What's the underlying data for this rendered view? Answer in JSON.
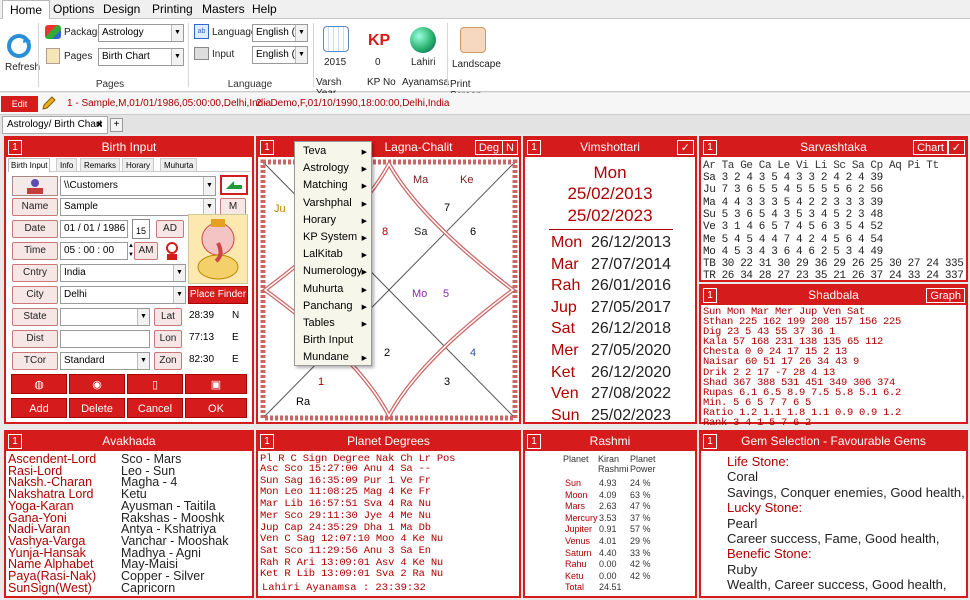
{
  "menu": {
    "tabs": [
      "Home",
      "Options",
      "Design",
      "Printing",
      "Masters",
      "Help"
    ]
  },
  "ribbon": {
    "refresh": "Refresh",
    "package_label": "Package",
    "package_value": "Astrology",
    "pages_label": "Pages",
    "pages_value": "Birth Chart",
    "pages_group": "Pages",
    "language_label": "Language",
    "language_value": "English (E",
    "input_label": "Input",
    "input_value": "English (E",
    "language_group": "Language",
    "varsh_value": "2015",
    "varsh_label": "Varsh Year",
    "kp_icon_text": "KP",
    "kp_value": "0",
    "kp_label": "KP No",
    "ayanamsa_value": "Lahiri",
    "ayanamsa_label": "Ayanamsa",
    "landscape_label": "Landscape",
    "print_screen_label": "Print Screen"
  },
  "profiles": {
    "edit_dob": "Edit DOB",
    "p1": "1 - Sample,M,01/01/1986,05:00:00,Delhi,India",
    "p2": "2 - Demo,F,01/10/1990,18:00:00,Delhi,India"
  },
  "doc_tab": {
    "label": "Astrology/ Birth Chart",
    "close": "✖",
    "add": "+"
  },
  "birth_input": {
    "num": "1",
    "title": "Birth Input",
    "subtabs": [
      "Birth Input",
      "Info",
      "Remarks",
      "Horary",
      "Muhurta"
    ],
    "folder": "\\\\Customers",
    "name_btn": "Name",
    "name_value": "Sample",
    "gender": "M",
    "date_btn": "Date",
    "date_value": "01 / 01 / 1986",
    "cal": "15",
    "ad": "AD",
    "time_btn": "Time",
    "time_value": "05 :  00 :  00",
    "ampm": "AM",
    "cntry_btn": "Cntry",
    "cntry_value": "India",
    "city_btn": "City",
    "city_value": "Delhi",
    "place_finder": "Place Finder",
    "state_btn": "State",
    "lat_btn": "Lat",
    "lat_value": "28:39",
    "lat_dir": "N",
    "dist_btn": "Dist",
    "lon_btn": "Lon",
    "lon_value": "77:13",
    "lon_dir": "E",
    "tcor_btn": "TCor",
    "tcor_value": "Standard",
    "zon_btn": "Zon",
    "zon_value": "82:30",
    "zon_dir": "E",
    "add": "Add",
    "delete": "Delete",
    "cancel": "Cancel",
    "ok": "OK"
  },
  "chart_panel": {
    "num": "1",
    "title": "Lagna-Chalit",
    "deg": "Deg",
    "n": "N",
    "houses": {
      "h12": "12",
      "h2": "2",
      "h7": "7",
      "h8": "8",
      "h6": "6",
      "h5": "5",
      "h3": "3",
      "h4": "4",
      "h1": "1",
      "h10": "10"
    },
    "planets": {
      "ma": "Ma",
      "ke": "Ke",
      "sa": "Sa",
      "ju": "Ju",
      "mo": "Mo",
      "ra": "Ra"
    }
  },
  "context_menu": {
    "items": [
      {
        "label": "Teva",
        "sub": true
      },
      {
        "label": "Astrology",
        "sub": true
      },
      {
        "label": "Matching",
        "sub": true
      },
      {
        "label": "Varshphal",
        "sub": true
      },
      {
        "label": "Horary",
        "sub": true
      },
      {
        "label": "KP System",
        "sub": true
      },
      {
        "label": "LalKitab",
        "sub": true
      },
      {
        "label": "Numerology",
        "sub": true
      },
      {
        "label": "Muhurta",
        "sub": true
      },
      {
        "label": "Panchang",
        "sub": true
      },
      {
        "label": "Tables",
        "sub": true
      },
      {
        "label": "Birth Input",
        "sub": false
      },
      {
        "label": "Mundane",
        "sub": true
      }
    ]
  },
  "vimshottari": {
    "num": "1",
    "title": "Vimshottari",
    "check": "✓",
    "header_day": "Mon",
    "header_d1": "25/02/2013",
    "header_d2": "25/02/2023",
    "rows": [
      {
        "p": "Mon",
        "d": "26/12/2013"
      },
      {
        "p": "Mar",
        "d": "27/07/2014"
      },
      {
        "p": "Rah",
        "d": "26/01/2016"
      },
      {
        "p": "Jup",
        "d": "27/05/2017"
      },
      {
        "p": "Sat",
        "d": "26/12/2018"
      },
      {
        "p": "Mer",
        "d": "27/05/2020"
      },
      {
        "p": "Ket",
        "d": "26/12/2020"
      },
      {
        "p": "Ven",
        "d": "27/08/2022"
      },
      {
        "p": "Sun",
        "d": "25/02/2023"
      }
    ]
  },
  "sarvashtaka": {
    "num": "1",
    "title": "Sarvashtaka",
    "chart_btn": "Chart",
    "check": "✓",
    "header": "   Ar Ta Ge Ca Le Vi Li Sc Sa Cp Aq Pi  Tt",
    "rows": [
      "Sa  3  2  4  3  5  4  3  3  2  4  2  4  39",
      "Ju  7  3  6  5  5  4  5  5  5  5  6  2  56",
      "Ma  4  4  3  3  3  5  4  2  2  3  3  3  39",
      "Su  5  3  6  5  4  3  5  3  4  5  2  3  48",
      "Ve  3  1  4  6  5  7  4  5  6  3  5  4  52",
      "Me  5  4  5  4  4  7  4  2  4  5  6  4  54",
      "Mo  4  5  3  4  3  6  4  6  2  5  3  4  49",
      "TB 30 22 31 30 29 36 29 26 25 30 27 24 335",
      "TR 26 34 28 27 23 35 21 26 37 24 33 24 337"
    ]
  },
  "shadbala": {
    "num": "1",
    "title": "Shadbala",
    "graph_btn": "Graph",
    "header": "       Sun  Mon  Mar  Mer  Jup  Ven  Sat",
    "rows": [
      "Sthan  225  162  199  208  157  156  225",
      "Dig     23    5   43   55   37   36    1",
      "Kala    57  168  231  138  135   65  112",
      "Chesta   0    0   24   17   15    2   13",
      "Naisar  60   51   17   26   34   43    9",
      "Drik     2    2   17   -7   28    4   13",
      "Shad   367  388  531  451  349  306  374",
      "Rupas  6.1  6.5  8.9  7.5  5.8  5.1  6.2",
      "Min.     5    6    5    7    7    6    5",
      "Ratio  1.2  1.1  1.8  1.1  0.9  0.9  1.2",
      "Rank     3    4    1    5    7    6    2"
    ]
  },
  "avakhada": {
    "num": "1",
    "title": "Avakhada",
    "rows": [
      {
        "k": "Ascendent-Lord",
        "v": "Sco - Mars"
      },
      {
        "k": "Rasi-Lord",
        "v": "Leo - Sun"
      },
      {
        "k": "Naksh.-Charan",
        "v": "Magha - 4"
      },
      {
        "k": "Nakshatra Lord",
        "v": "Ketu"
      },
      {
        "k": "Yoga-Karan",
        "v": "Ayusman - Taitila"
      },
      {
        "k": "Gana-Yoni",
        "v": "Rakshas - Mooshk"
      },
      {
        "k": "Nadi-Varan",
        "v": "Antya - Kshatriya"
      },
      {
        "k": "Vashya-Varga",
        "v": "Vanchar - Mooshak"
      },
      {
        "k": "Yunja-Hansak",
        "v": "Madhya - Agni"
      },
      {
        "k": "Name Alphabet",
        "v": "May-Maisi"
      },
      {
        "k": "Paya(Rasi-Nak)",
        "v": "Copper - Silver"
      },
      {
        "k": "SunSign(West)",
        "v": "Capricorn"
      }
    ]
  },
  "planet_degrees": {
    "num": "1",
    "title": "Planet Degrees",
    "header": " Pl   R  C  Sign  Degree   Nak  Ch  Lr  Pos",
    "rows": [
      "Asc         Sco  15:27:00  Anu  4   Sa  -- ",
      "Sun         Sag  16:35:09  Pur  1   Ve  Fr ",
      "Mon         Leo  11:08:25  Mag  4   Ke  Fr ",
      "Mar         Lib  16:57:51  Sva  4   Ra  Nu ",
      "Mer         Sco  29:11:30  Jye  4   Me  Nu ",
      "Jup         Cap  24:35:29  Dha  1   Ma  Db ",
      "Ven      C  Sag  12:07:10  Moo  4   Ke  Nu ",
      "Sat         Sco  11:29:56  Anu  3   Sa  En ",
      "Rah  R      Ari  13:09:01  Asv  4   Ke  Nu ",
      "Ket  R      Lib  13:09:01  Sva  2   Ra  Nu "
    ],
    "footer": "Lahiri Ayanamsa : 23:39:32"
  },
  "rashmi": {
    "num": "1",
    "title": "Rashmi",
    "h_planet": "Planet",
    "h_kiran": "Kiran",
    "h_rashmi": "Rashmi",
    "h_pplanet": "Planet",
    "h_power": "Power",
    "rows": [
      {
        "p": "Sun",
        "k": "4.93",
        "w": "24 %"
      },
      {
        "p": "Moon",
        "k": "4.09",
        "w": "63 %"
      },
      {
        "p": "Mars",
        "k": "2.63",
        "w": "47 %"
      },
      {
        "p": "Mercury",
        "k": "3.53",
        "w": "37 %"
      },
      {
        "p": "Jupiter",
        "k": "0.91",
        "w": "57 %"
      },
      {
        "p": "Venus",
        "k": "4.01",
        "w": "29 %"
      },
      {
        "p": "Saturn",
        "k": "4.40",
        "w": "33 %"
      },
      {
        "p": "Rahu",
        "k": "0.00",
        "w": "42 %"
      },
      {
        "p": "Ketu",
        "k": "0.00",
        "w": "42 %"
      },
      {
        "p": "Total",
        "k": "24.51",
        "w": ""
      }
    ]
  },
  "gems": {
    "num": "1",
    "title": "Gem Selection - Favourable Gems",
    "lines": [
      {
        "t": "Life Stone:",
        "red": true
      },
      {
        "t": "Coral",
        "red": false
      },
      {
        "t": "Savings, Conquer enemies, Good health,",
        "red": false
      },
      {
        "t": "Lucky Stone:",
        "red": true
      },
      {
        "t": "Pearl",
        "red": false
      },
      {
        "t": "Career success, Fame, Good health,",
        "red": false
      },
      {
        "t": "Benefic Stone:",
        "red": true
      },
      {
        "t": "Ruby",
        "red": false
      },
      {
        "t": "Wealth, Career success, Good health,",
        "red": false
      }
    ]
  }
}
